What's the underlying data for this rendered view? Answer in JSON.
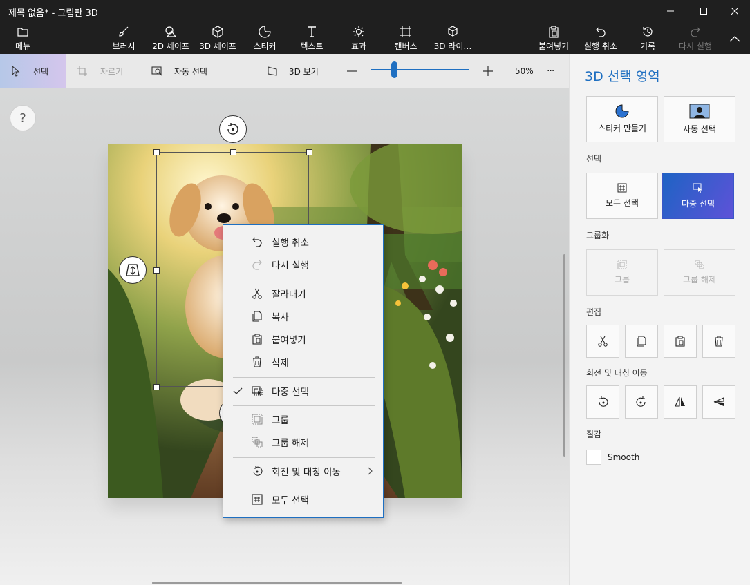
{
  "window": {
    "title": "제목 없음* - 그림판 3D"
  },
  "menubar": {
    "menu_label": "메뉴",
    "tools": [
      "브러시",
      "2D 셰이프",
      "3D 셰이프",
      "스티커",
      "텍스트",
      "효과",
      "캔버스",
      "3D 라이…"
    ],
    "paste_label": "붙여넣기",
    "undo_label": "실행 취소",
    "history_label": "기록",
    "redo_label": "다시 실행"
  },
  "commandbar": {
    "select_label": "선택",
    "crop_label": "자르기",
    "magic_select_label": "자동 선택",
    "view3d_label": "3D 보기",
    "zoom_label": "50%",
    "zoom_value": 0.25,
    "more_label": "···"
  },
  "canvas": {
    "help_label": "?"
  },
  "context_menu": {
    "items": [
      {
        "label": "실행 취소",
        "icon": "undo-icon",
        "enabled": true
      },
      {
        "label": "다시 실행",
        "icon": "redo-icon",
        "enabled": false
      },
      {
        "label": "잘라내기",
        "icon": "cut-icon",
        "enabled": true
      },
      {
        "label": "복사",
        "icon": "copy-icon",
        "enabled": true
      },
      {
        "label": "붙여넣기",
        "icon": "paste-icon",
        "enabled": true
      },
      {
        "label": "삭제",
        "icon": "delete-icon",
        "enabled": true
      },
      {
        "label": "다중 선택",
        "icon": "multi-select-icon",
        "checked": true
      },
      {
        "label": "그룹",
        "icon": "group-icon",
        "enabled": true
      },
      {
        "label": "그룹 해제",
        "icon": "ungroup-icon",
        "enabled": true
      },
      {
        "label": "회전 및 대칭 이동",
        "icon": "rotate-flip-icon",
        "submenu": true
      },
      {
        "label": "모두 선택",
        "icon": "select-all-icon",
        "enabled": true
      }
    ]
  },
  "panel": {
    "title": "3D 선택 영역",
    "make_sticker_label": "스티커 만들기",
    "magic_select_label": "자동 선택",
    "selection_heading": "선택",
    "select_all_label": "모두 선택",
    "multi_select_label": "다중 선택",
    "grouping_heading": "그룹화",
    "group_label": "그룹",
    "ungroup_label": "그룹 해제",
    "edit_heading": "편집",
    "rotate_heading": "회전 및 대칭 이동",
    "texture_heading": "질감",
    "texture_value": "Smooth"
  },
  "colors": {
    "accent": "#1e6fc1",
    "active_gradient_start": "#1e63c4",
    "active_gradient_end": "#5e52d8"
  }
}
